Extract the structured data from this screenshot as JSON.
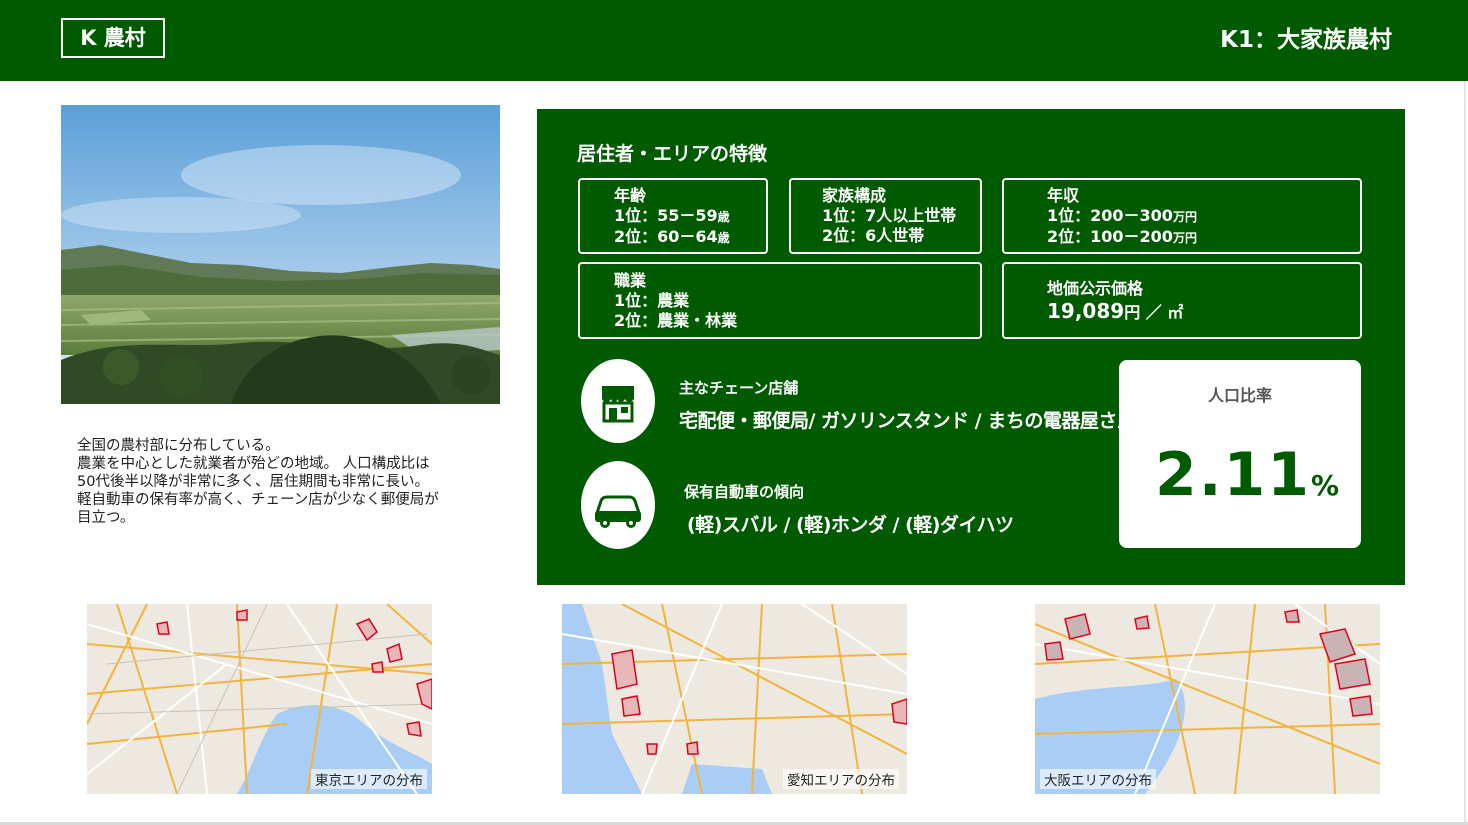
{
  "header": {
    "tag": "K 農村",
    "title": "K1：大家族農村"
  },
  "description": [
    "全国の農村部に分布している。",
    "農業を中心とした就業者が殆どの地域。 人口構成比は",
    "50代後半以降が非常に多く、居住期間も非常に長い。",
    "軽自動車の保有率が高く、チェーン店が少なく郵便局が",
    "目立つ。"
  ],
  "features": {
    "title": "居住者・エリアの特徴",
    "age": {
      "label": "年齢",
      "line1": "1位：55－59",
      "line1_unit": "歳",
      "line2": "2位：60－64",
      "line2_unit": "歳"
    },
    "family": {
      "label": "家族構成",
      "line1": "1位：7人以上世帯",
      "line2": "2位：6人世帯"
    },
    "income": {
      "label": "年収",
      "line1": "1位：200－300",
      "line1_unit": "万円",
      "line2": "2位：100－200",
      "line2_unit": "万円"
    },
    "job": {
      "label": "職業",
      "line1": "1位：農業",
      "line2": "2位：農業・林業"
    },
    "land": {
      "label": "地価公示価格",
      "value": "19,089",
      "unit": "円 ／ ㎡"
    }
  },
  "chain": {
    "title": "主なチェーン店舗",
    "text": "宅配便・郵便局/ ガソリンスタンド / まちの電器屋さん",
    "icon": "store-icon"
  },
  "car": {
    "title": "保有自動車の傾向",
    "text": "(軽)スバル / (軽)ホンダ / (軽)ダイハツ",
    "icon": "car-icon"
  },
  "ratio": {
    "label": "人口比率",
    "value": "2.11",
    "unit": "%"
  },
  "maps": [
    {
      "caption": "東京エリアの分布"
    },
    {
      "caption": "愛知エリアの分布"
    },
    {
      "caption": "大阪エリアの分布"
    }
  ],
  "colors": {
    "brand_green": "#005a00",
    "highlight_red": "#e0001b"
  }
}
